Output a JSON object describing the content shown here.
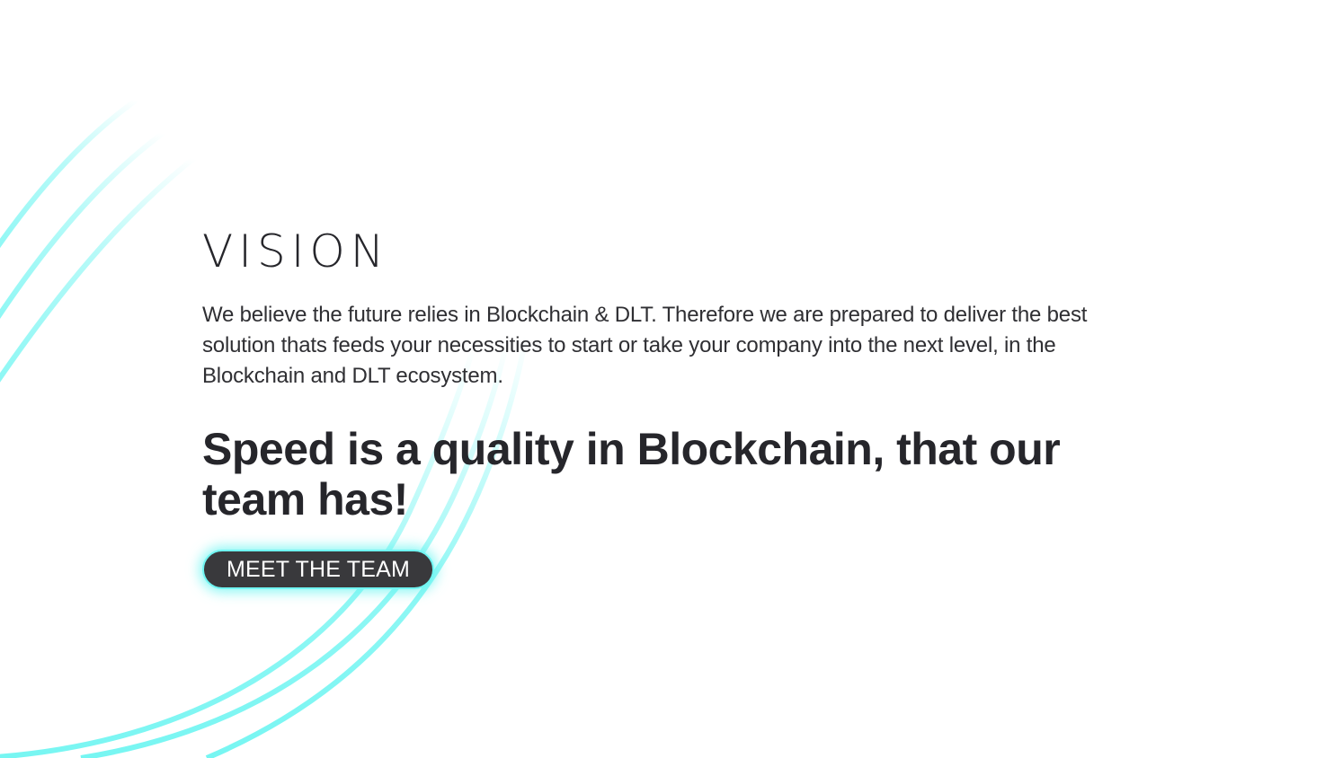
{
  "vision": {
    "title": "VISION",
    "body": "We believe the future relies in Blockchain & DLT. Therefore we are prepared to deliver the best solution thats feeds your necessities to start or take your company into the next level, in the Blockchain and DLT ecosystem.",
    "tagline": "Speed is a quality in Blockchain, that our team has!",
    "cta_label": "MEET THE TEAM"
  },
  "theme": {
    "accent_color": "#5ef4f0",
    "button_color": "#39393c",
    "text_color": "#26262b",
    "background_color": "#ffffff"
  }
}
